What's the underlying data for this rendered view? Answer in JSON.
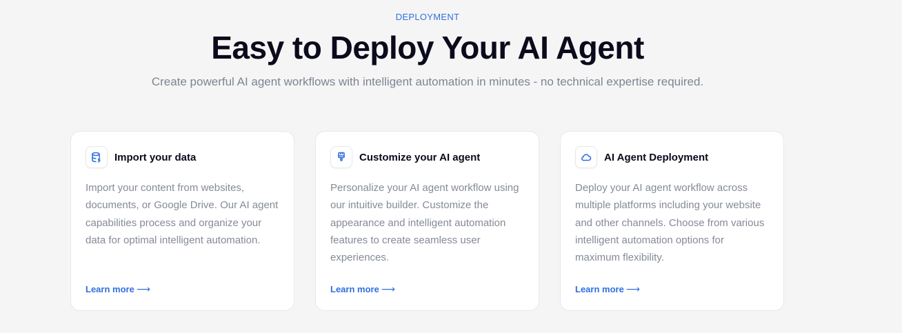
{
  "header": {
    "eyebrow": "DEPLOYMENT",
    "title": "Easy to Deploy Your AI Agent",
    "subtitle": "Create powerful AI agent workflows with intelligent automation in minutes - no technical expertise required."
  },
  "cards": [
    {
      "icon": "database-icon",
      "title": "Import your data",
      "description": "Import your content from websites, documents, or Google Drive. Our AI agent capabilities process and organize your data for optimal intelligent automation.",
      "link": "Learn more",
      "arrow": "⟶"
    },
    {
      "icon": "paintbrush-icon",
      "title": "Customize your AI agent",
      "description": "Personalize your AI agent workflow using our intuitive builder. Customize the appearance and intelligent automation features to create seamless user experiences.",
      "link": "Learn more",
      "arrow": "⟶"
    },
    {
      "icon": "cloud-icon",
      "title": "AI Agent Deployment",
      "description": "Deploy your AI agent workflow across multiple platforms including your website and other channels. Choose from various intelligent automation options for maximum flexibility.",
      "link": "Learn more",
      "arrow": "⟶"
    }
  ],
  "colors": {
    "accent": "#2f6fe0",
    "background": "#f5f5f5",
    "card": "#ffffff",
    "muted_text": "#848a96"
  }
}
